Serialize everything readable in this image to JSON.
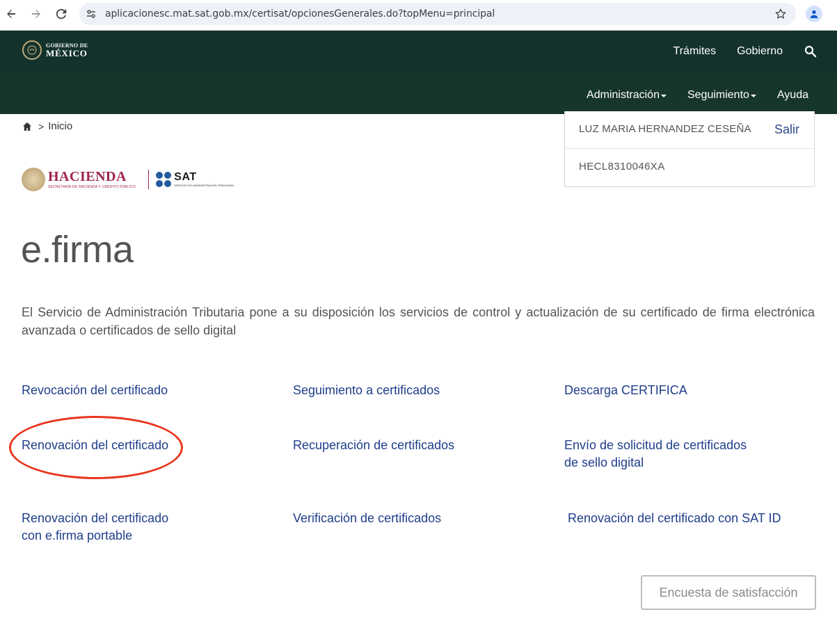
{
  "browser": {
    "url": "aplicacionesc.mat.sat.gob.mx/certisat/opcionesGenerales.do?topMenu=principal",
    "back_icon": "arrow-left-icon",
    "forward_icon": "arrow-right-icon",
    "reload_icon": "reload-icon",
    "bookmark_icon": "star-icon",
    "profile_icon": "person-icon"
  },
  "gov_header": {
    "logo_line1": "GOBIERNO DE",
    "logo_line2": "MÉXICO",
    "nav": [
      "Trámites",
      "Gobierno"
    ],
    "search_icon": "search-icon",
    "bg_color": "#13322b"
  },
  "sub_nav": {
    "items": [
      {
        "label": "Administración",
        "has_dropdown": true
      },
      {
        "label": "Seguimiento",
        "has_dropdown": true
      },
      {
        "label": "Ayuda",
        "has_dropdown": false
      }
    ]
  },
  "breadcrumb": {
    "home_icon": "home-icon",
    "separator": ">",
    "current": "Inicio"
  },
  "user": {
    "name": "LUZ MARIA HERNANDEZ CESEÑA",
    "logout_label": "Salir",
    "rfc": "HECL8310046XA"
  },
  "branding": {
    "hacienda": "HACIENDA",
    "hacienda_sub": "SECRETARÍA DE HACIENDA Y CRÉDITO PÚBLICO",
    "sat": "SAT",
    "sat_sub": "SERVICIO DE ADMINISTRACIÓN TRIBUTARIA",
    "hacienda_color": "#9d2449",
    "sat_color": "#235b9f"
  },
  "main": {
    "title": "e.firma",
    "description": "El Servicio de Administración Tributaria pone a su disposición los servicios de control y actualización de su certificado de firma electrónica avanzada o certificados de sello digital",
    "links": [
      {
        "line1": "Revocación del certificado"
      },
      {
        "line1": "Seguimiento a certificados"
      },
      {
        "line1": "Descarga CERTIFICA"
      },
      {
        "line1": "Renovación del certificado"
      },
      {
        "line1": "Recuperación de certificados"
      },
      {
        "line1": "Envío de solicitud de certificados",
        "line2": "de sello digital"
      },
      {
        "line1": "Renovación del certificado",
        "line2": "con e.firma portable"
      },
      {
        "line1": "Verificación de certificados"
      },
      {
        "line1": "Renovación del certificado con SAT ID"
      }
    ],
    "link_color": "#1f3d8a",
    "highlight_color": "#e8361e"
  },
  "survey_button": "Encuesta de satisfacción"
}
